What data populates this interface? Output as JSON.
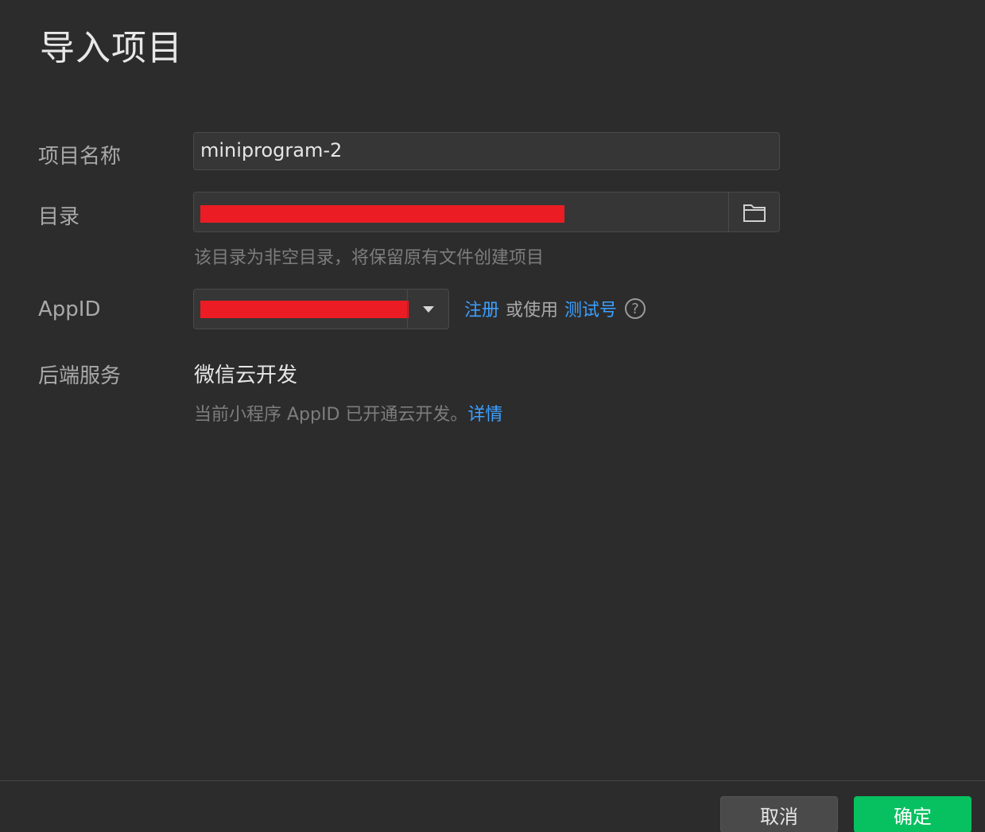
{
  "dialog": {
    "title": "导入项目"
  },
  "form": {
    "project_name": {
      "label": "项目名称",
      "value": "miniprogram-2"
    },
    "directory": {
      "label": "目录",
      "hint": "该目录为非空目录，将保留原有文件创建项目",
      "icon": "folder-icon"
    },
    "appid": {
      "label": "AppID",
      "register_link": "注册",
      "or_use_text": "或使用",
      "test_account_link": "测试号",
      "help_icon": "?"
    },
    "backend": {
      "label": "后端服务",
      "value": "微信云开发",
      "hint": "当前小程序 AppID 已开通云开发。",
      "details_link": "详情"
    }
  },
  "footer": {
    "cancel_label": "取消",
    "confirm_label": "确定"
  },
  "colors": {
    "background": "#2c2c2c",
    "link": "#3d9fff",
    "confirm": "#07c160",
    "redaction": "#ec1c24"
  }
}
